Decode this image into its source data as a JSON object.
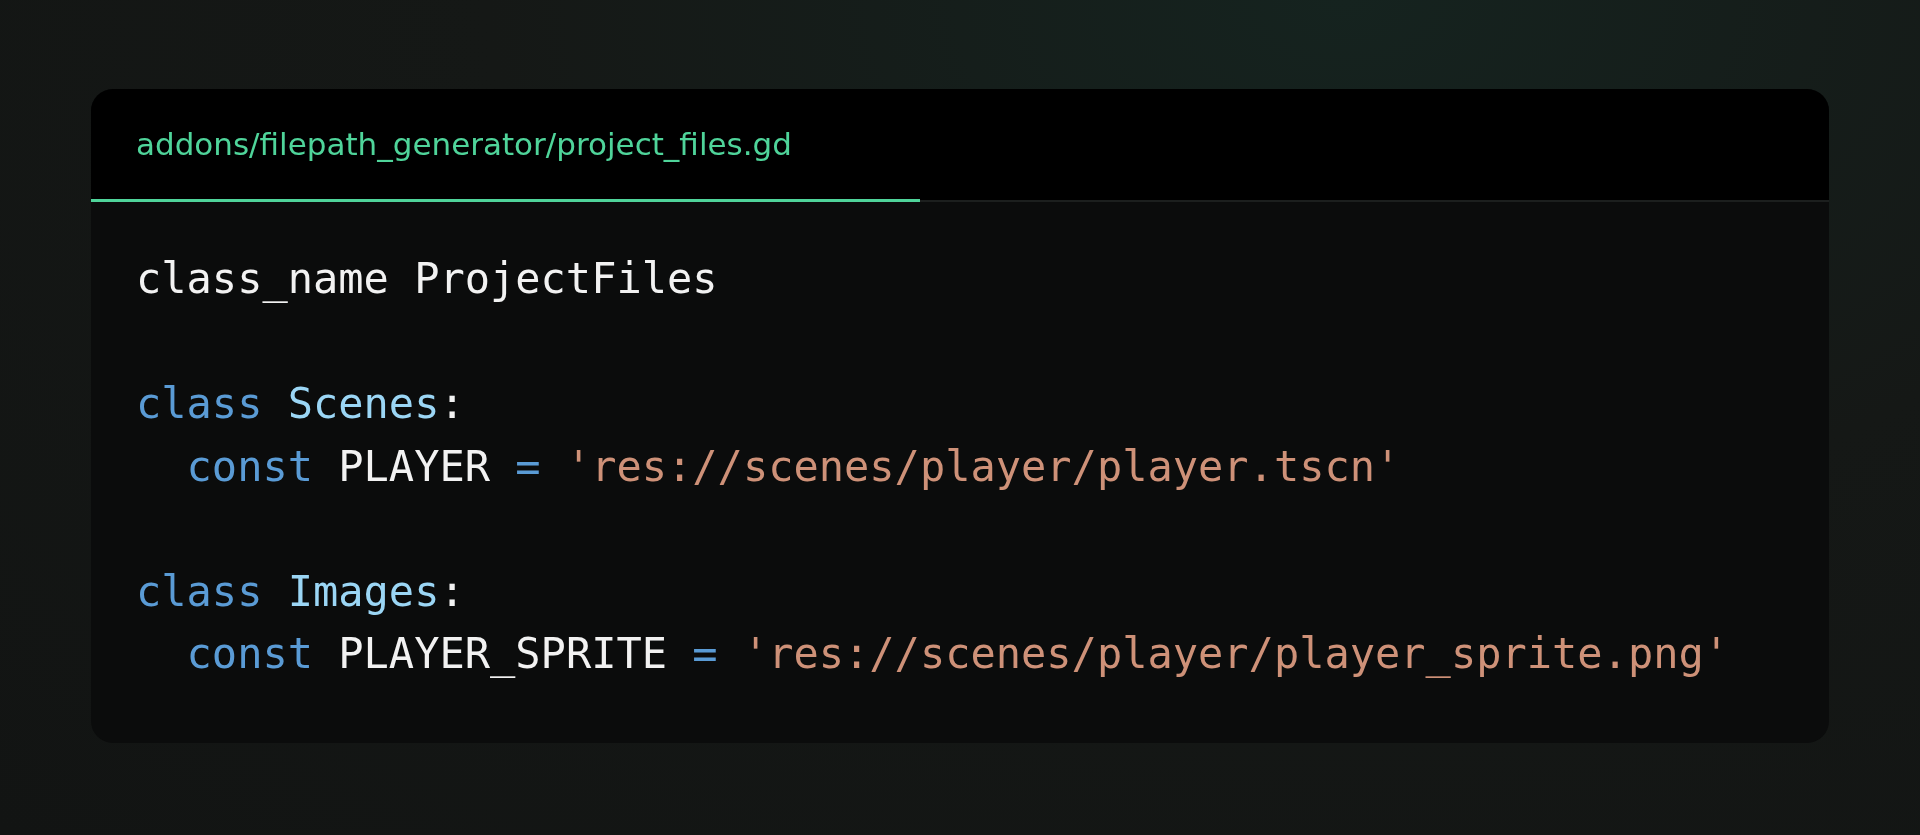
{
  "tabs": [
    {
      "label": "addons/filepath_generator/project_files.gd",
      "selected": true
    }
  ],
  "code": [
    {
      "kind": "code",
      "tokens": [
        {
          "kind": "plain",
          "text": "class_name ProjectFiles"
        }
      ]
    },
    {
      "kind": "blank"
    },
    {
      "kind": "code",
      "tokens": [
        {
          "kind": "keyword",
          "text": "class"
        },
        {
          "kind": "type",
          "text": " Scenes"
        },
        {
          "kind": "plain",
          "text": ":"
        }
      ]
    },
    {
      "kind": "code",
      "tokens": [
        {
          "kind": "keyword",
          "text": "  const"
        },
        {
          "kind": "plain",
          "text": " PLAYER "
        },
        {
          "kind": "operator",
          "text": "="
        },
        {
          "kind": "string",
          "text": " 'res://scenes/player/player.tscn'"
        }
      ]
    },
    {
      "kind": "blank"
    },
    {
      "kind": "code",
      "tokens": [
        {
          "kind": "keyword",
          "text": "class"
        },
        {
          "kind": "type",
          "text": " Images"
        },
        {
          "kind": "plain",
          "text": ":"
        }
      ]
    },
    {
      "kind": "code",
      "tokens": [
        {
          "kind": "keyword",
          "text": "  const"
        },
        {
          "kind": "plain",
          "text": " PLAYER_SPRITE "
        },
        {
          "kind": "operator",
          "text": "="
        },
        {
          "kind": "string",
          "text": " 'res://scenes/player/player_sprite.png'"
        }
      ]
    }
  ]
}
